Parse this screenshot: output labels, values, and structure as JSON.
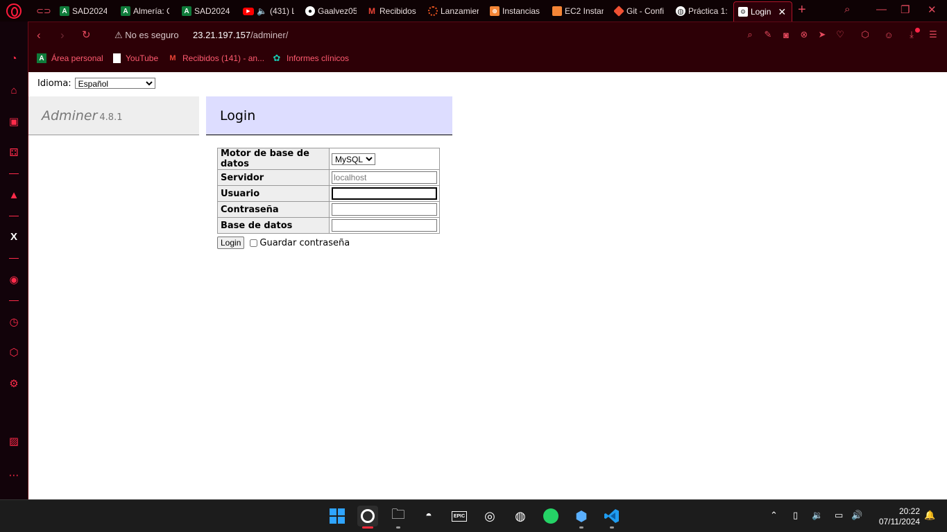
{
  "tabs": [
    {
      "title": "SAD2024:",
      "icon": "moodle-a-icon",
      "color": "#0f7b3a"
    },
    {
      "title": "Almería: C",
      "icon": "moodle-a-icon",
      "color": "#0f7b3a"
    },
    {
      "title": "SAD2024:",
      "icon": "moodle-a-icon",
      "color": "#0f7b3a"
    },
    {
      "title": "(431) L",
      "icon": "youtube-icon",
      "color": "#ff0000"
    },
    {
      "title": "Gaalvez05",
      "icon": "github-icon",
      "color": "#ffffff"
    },
    {
      "title": "Recibidos",
      "icon": "gmail-icon",
      "color": "#ea4335"
    },
    {
      "title": "Lanzamier",
      "icon": "ubuntu-icon",
      "color": "#e95420"
    },
    {
      "title": "Instancias",
      "icon": "aws-icon",
      "color": "#f58536"
    },
    {
      "title": "EC2 Instan",
      "icon": "aws-cube-icon",
      "color": "#f58536"
    },
    {
      "title": "Git - Confi",
      "icon": "git-icon",
      "color": "#f05133"
    },
    {
      "title": "Práctica 1:",
      "icon": "globe-icon",
      "color": "#ffffff"
    },
    {
      "title": "Login",
      "icon": "adminer-icon",
      "color": "#ffffff",
      "active": true
    }
  ],
  "address_bar": {
    "security_text": "No es seguro",
    "url_host": "23.21.197.157",
    "url_path": "/adminer/"
  },
  "bookmarks": [
    {
      "label": "Área personal",
      "icon": "moodle-a-icon",
      "color": "#0f7b3a"
    },
    {
      "label": "YouTube",
      "icon": "page-icon",
      "color": "#ffffff"
    },
    {
      "label": "Recibidos (141) - an...",
      "icon": "gmail-icon",
      "color": "#ea4335"
    },
    {
      "label": "Informes clínicos",
      "icon": "gear-flower-icon",
      "color": "#19c7b0"
    }
  ],
  "page": {
    "language_label": "Idioma:",
    "language_value": "Español",
    "app_name": "Adminer",
    "app_version": "4.8.1",
    "heading": "Login",
    "fields": [
      {
        "label": "Motor de base de datos",
        "type": "select",
        "value": "MySQL"
      },
      {
        "label": "Servidor",
        "type": "text",
        "placeholder": "localhost",
        "value": ""
      },
      {
        "label": "Usuario",
        "type": "text",
        "placeholder": "",
        "value": "",
        "focused": true
      },
      {
        "label": "Contraseña",
        "type": "password",
        "placeholder": "",
        "value": ""
      },
      {
        "label": "Base de datos",
        "type": "text",
        "placeholder": "",
        "value": ""
      }
    ],
    "submit_label": "Login",
    "remember_label": "Guardar contraseña"
  },
  "taskbar": {
    "time": "20:22",
    "date": "07/11/2024"
  },
  "colors": {
    "accent": "#ff1b3c",
    "chrome_bg": "#2d0006",
    "adminer_head": "#ddddff"
  }
}
